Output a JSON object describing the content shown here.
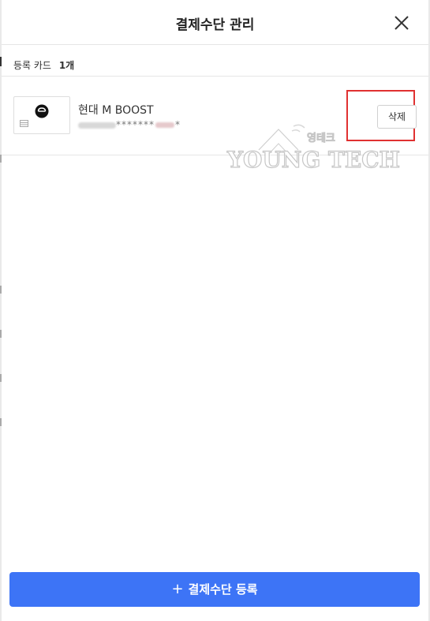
{
  "modal": {
    "title": "결제수단 관리",
    "close_icon": "close-icon"
  },
  "summary": {
    "label": "등록 카드",
    "count": "1개"
  },
  "card": {
    "name": "현대 M BOOST",
    "number_mask_a": "*******",
    "number_mask_b": "*",
    "delete_label": "삭제"
  },
  "watermark": {
    "brand": "YOUNG TECH",
    "brand_ko": "영테크"
  },
  "footer": {
    "plus_icon": "+",
    "register_label": "결제수단 등록"
  },
  "colors": {
    "primary": "#3d74f6",
    "highlight": "#e03131"
  }
}
